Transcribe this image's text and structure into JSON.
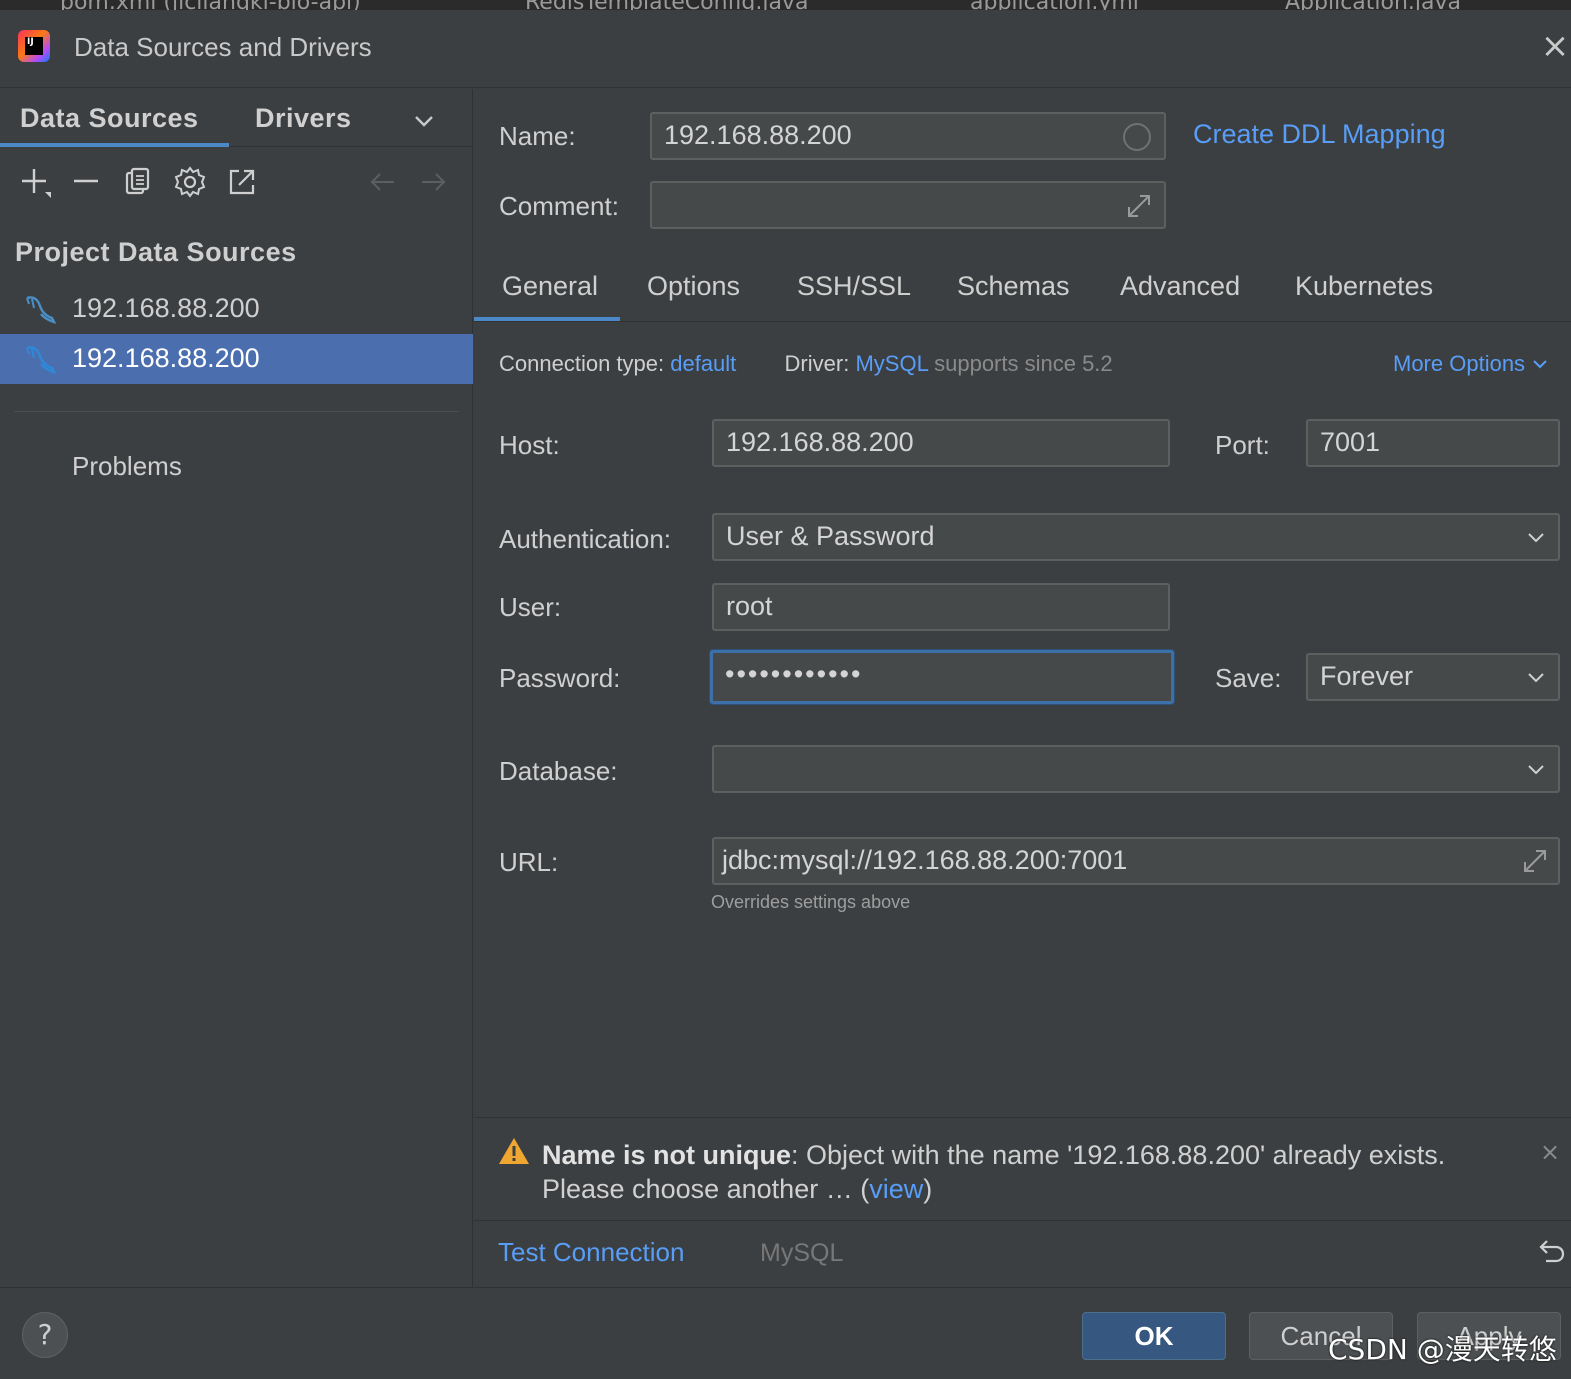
{
  "editor_tabs": [
    "pom.xml (jiclianqki-bio-api)",
    "RedisTemplateConfig.java",
    "application.yml",
    "Application.java"
  ],
  "window": {
    "title": "Data Sources and Drivers",
    "close": "×"
  },
  "left": {
    "tabs": [
      "Data Sources",
      "Drivers"
    ],
    "section_title": "Project Data Sources",
    "items": [
      {
        "label": "192.168.88.200",
        "selected": false
      },
      {
        "label": "192.168.88.200",
        "selected": true
      }
    ],
    "problems": "Problems",
    "toolbar": [
      "add-icon",
      "remove-icon",
      "duplicate-icon",
      "settings-icon",
      "export-icon",
      "back-icon",
      "forward-icon"
    ]
  },
  "form": {
    "name_label": "Name:",
    "name_value": "192.168.88.200",
    "create_ddl": "Create DDL Mapping",
    "comment_label": "Comment:",
    "comment_value": "",
    "tabs": [
      "General",
      "Options",
      "SSH/SSL",
      "Schemas",
      "Advanced",
      "Kubernetes"
    ],
    "active_tab": "General",
    "conn_type_label": "Connection type:",
    "conn_type_value": "default",
    "driver_label": "Driver:",
    "driver_value": "MySQL",
    "driver_note": "supports since 5.2",
    "more_options": "More Options",
    "host_label": "Host:",
    "host_value": "192.168.88.200",
    "port_label": "Port:",
    "port_value": "7001",
    "auth_label": "Authentication:",
    "auth_value": "User & Password",
    "user_label": "User:",
    "user_value": "root",
    "password_label": "Password:",
    "password_value": "••••••••••••",
    "save_label": "Save:",
    "save_value": "Forever",
    "database_label": "Database:",
    "database_value": "",
    "url_label": "URL:",
    "url_value": "jdbc:mysql://192.168.88.200:7001",
    "url_hint": "Overrides settings above"
  },
  "warning": {
    "title": "Name is not unique",
    "message": ": Object with the name '192.168.88.200' already exists. Please choose another … (",
    "link": "view",
    "end": ")",
    "close": "×"
  },
  "footer": {
    "test_connection": "Test Connection",
    "driver_name": "MySQL",
    "help": "?",
    "ok": "OK",
    "cancel": "Cancel",
    "apply": "Apply",
    "watermark": "CSDN @漫天转悠"
  },
  "colors": {
    "background": "#3c3f41",
    "accent": "#4a88c7",
    "link": "#589df6",
    "selection": "#4b6eaf",
    "ok_button": "#365880",
    "warning": "#f0a732"
  }
}
